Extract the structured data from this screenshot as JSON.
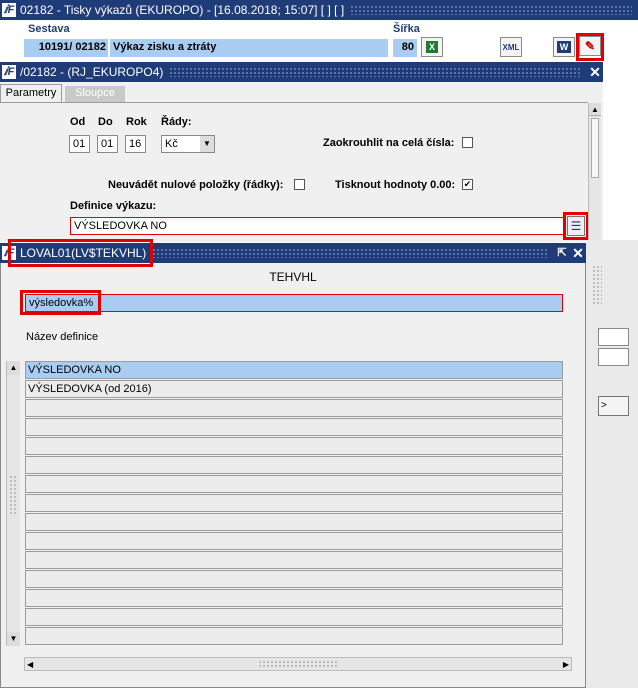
{
  "main_window": {
    "title": "02182 - Tisky výkazů (EKUROPO) - [16.08.2018; 15:07]  [ ] [ ]",
    "icon": "app-logo-icon"
  },
  "header": {
    "sestava_label": "Sestava",
    "sirka_label": "Šířka",
    "code1": "10191",
    "code2": "/ 02182",
    "report_name": "Výkaz zisku a ztráty",
    "sirka_value": "80"
  },
  "subwindow": {
    "title": "/02182 - (RJ_EKUROPO4)",
    "close": "✕"
  },
  "tabs": [
    {
      "label": "Parametry"
    },
    {
      "label": "Sloupce"
    }
  ],
  "params": {
    "od_label": "Od",
    "do_label": "Do",
    "rok_label": "Rok",
    "rady_label": "Řády:",
    "od": "01",
    "do": "01",
    "rok": "16",
    "rady": "Kč",
    "zaokrouhlit_label": "Zaokrouhlit na celá čísla:",
    "neuvadet_label": "Neuvádět nulové položky (řádky):",
    "tisknout_label": "Tisknout hodnoty 0.00:",
    "tisknout_check": "✔",
    "definice_label": "Definice výkazu:",
    "definice_value": "VÝSLEDOVKA NO"
  },
  "lov": {
    "title": "LOVAL01(LV$TEKVHL)",
    "heading": "TEHVHL",
    "search": "výsledovka%",
    "col_label": "Název definice",
    "rows": [
      "VÝSLEDOVKA NO",
      "VÝSLEDOVKA (od 2016)",
      "",
      "",
      "",
      "",
      "",
      "",
      "",
      "",
      "",
      "",
      "",
      "",
      ""
    ]
  }
}
